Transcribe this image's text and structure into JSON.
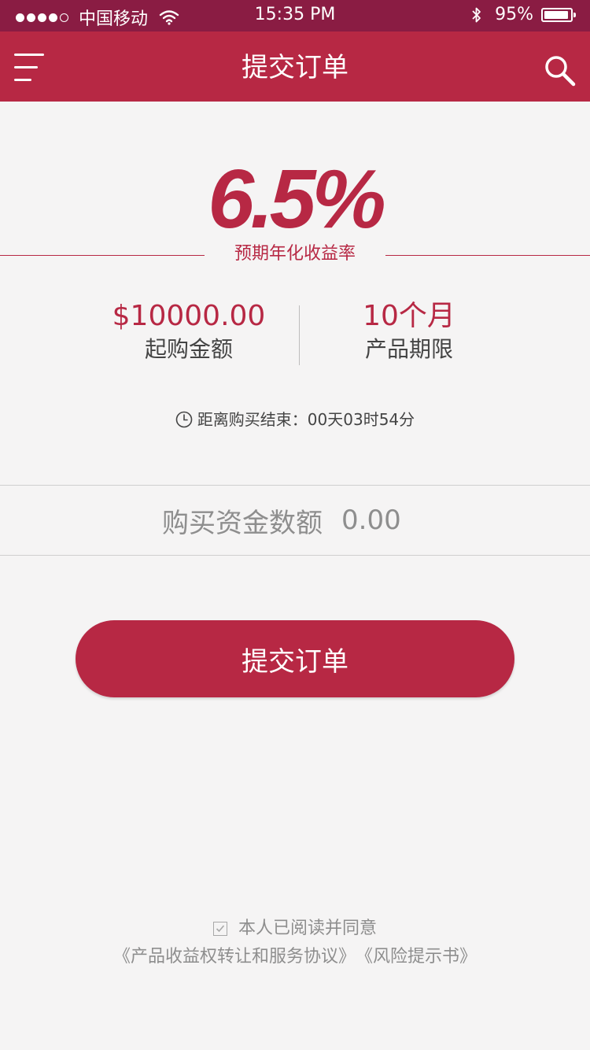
{
  "status_bar": {
    "carrier": "中国移动",
    "time": "15:35 PM",
    "battery": "95%",
    "battery_level": 0.95,
    "signal_bars": 4
  },
  "header": {
    "title": "提交订单",
    "menu_icon": "menu-icon",
    "search_icon": "search-icon"
  },
  "product": {
    "rate": "6.5%",
    "rate_label": "预期年化收益率",
    "min_amount": "$10000.00",
    "min_amount_label": "起购金额",
    "term": "10个月",
    "term_label": "产品期限",
    "countdown": "距离购买结束：00天03时54分"
  },
  "purchase": {
    "label": "购买资金数额",
    "placeholder": "0.00"
  },
  "submit_button": "提交订单",
  "agreement": {
    "text": "本人已阅读并同意",
    "checked": true,
    "doc1": "《产品收益权转让和服务协议》",
    "doc2": "《风险提示书》"
  },
  "colors": {
    "status_bar": "#8a1c43",
    "brand": "#b72844",
    "background": "#f5f4f4",
    "muted_text": "#8e8e8e"
  }
}
